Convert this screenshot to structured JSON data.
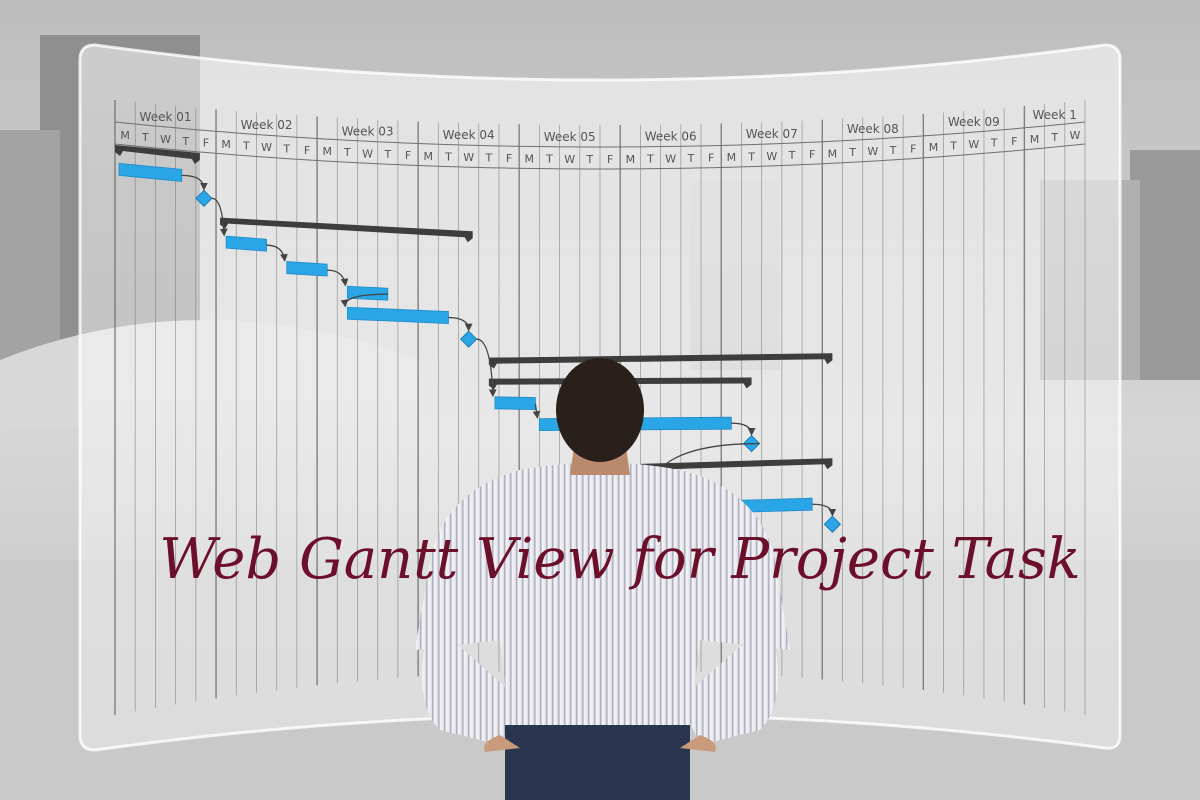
{
  "title": "Web Gantt View for Project Task",
  "colors": {
    "title": "#6b0f2a",
    "task_bar": "#2aa5e6",
    "summary_bar": "#3d3d3d",
    "milestone": "#2aa5e6",
    "arrow": "#444444",
    "grid": "#6f6f6f",
    "panel": "#f2f2f2"
  },
  "gantt": {
    "weeks": [
      "Week 01",
      "Week 02",
      "Week 03",
      "Week 04",
      "Week 05",
      "Week 06",
      "Week 07",
      "Week 08",
      "Week 09",
      "Week 1"
    ],
    "days": [
      "M",
      "T",
      "W",
      "T",
      "F"
    ],
    "last_week_days": [
      "M",
      "T",
      "W"
    ],
    "items": [
      {
        "type": "summary",
        "start": 0,
        "end": 4.2,
        "row": 0
      },
      {
        "type": "task",
        "start": 0.2,
        "end": 3.3,
        "row": 1
      },
      {
        "type": "milestone",
        "at": 4.4,
        "row": 2
      },
      {
        "type": "summary",
        "start": 5.2,
        "end": 17.7,
        "row": 3
      },
      {
        "type": "task",
        "start": 5.5,
        "end": 7.5,
        "row": 4
      },
      {
        "type": "task",
        "start": 8.5,
        "end": 10.5,
        "row": 5
      },
      {
        "type": "task",
        "start": 11.5,
        "end": 13.5,
        "row": 6
      },
      {
        "type": "task",
        "start": 11.5,
        "end": 16.5,
        "row": 7
      },
      {
        "type": "milestone",
        "at": 17.5,
        "row": 8
      },
      {
        "type": "summary",
        "start": 18.5,
        "end": 35.5,
        "row": 9
      },
      {
        "type": "summary",
        "start": 18.5,
        "end": 31.5,
        "row": 10
      },
      {
        "type": "task",
        "start": 18.8,
        "end": 20.8,
        "row": 11
      },
      {
        "type": "task",
        "start": 21.0,
        "end": 30.5,
        "row": 12
      },
      {
        "type": "milestone",
        "at": 31.5,
        "row": 13
      },
      {
        "type": "summary",
        "start": 26.0,
        "end": 35.5,
        "row": 14
      },
      {
        "type": "task",
        "start": 26.5,
        "end": 34.5,
        "row": 16
      },
      {
        "type": "milestone",
        "at": 35.5,
        "row": 17
      }
    ]
  }
}
